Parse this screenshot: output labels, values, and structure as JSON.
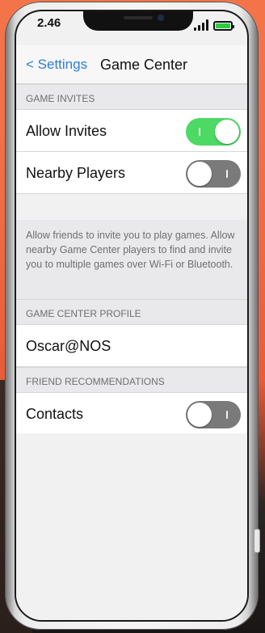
{
  "status_bar": {
    "time": "2.46",
    "signal_icon": "signal-bars-icon",
    "battery_icon": "battery-icon",
    "battery_color": "#2ecc40"
  },
  "nav": {
    "back_label": "< Settings",
    "title": "Game Center",
    "accent_color": "#2f7dd6"
  },
  "sections": {
    "game_invites": {
      "header": "GAME INVITES",
      "rows": [
        {
          "label": "Allow Invites",
          "toggle": "on"
        },
        {
          "label": "Nearby Players",
          "toggle": "off"
        }
      ],
      "footer": "Allow friends to invite you to play games. Allow nearby Game Center players to find and invite you to multiple games over Wi-Fi or Bluetooth."
    },
    "profile": {
      "header": "GAME CENTER PROFILE",
      "name": "Oscar@NOS"
    },
    "friend_recommendations": {
      "header": "FRIEND RECOMMENDATIONS",
      "rows": [
        {
          "label": "Contacts",
          "toggle": "off"
        }
      ]
    }
  },
  "colors": {
    "toggle_on": "#4cd964",
    "toggle_off": "#7a7a7a"
  }
}
